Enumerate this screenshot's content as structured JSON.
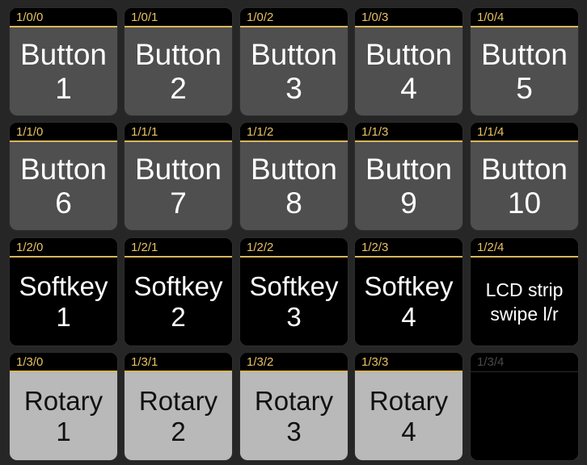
{
  "grid": {
    "rows": [
      [
        {
          "loc": "1/0/0",
          "label": "Button\n1",
          "style": "dark"
        },
        {
          "loc": "1/0/1",
          "label": "Button\n2",
          "style": "dark"
        },
        {
          "loc": "1/0/2",
          "label": "Button\n3",
          "style": "dark"
        },
        {
          "loc": "1/0/3",
          "label": "Button\n4",
          "style": "dark"
        },
        {
          "loc": "1/0/4",
          "label": "Button\n5",
          "style": "dark"
        }
      ],
      [
        {
          "loc": "1/1/0",
          "label": "Button\n6",
          "style": "dark"
        },
        {
          "loc": "1/1/1",
          "label": "Button\n7",
          "style": "dark"
        },
        {
          "loc": "1/1/2",
          "label": "Button\n8",
          "style": "dark"
        },
        {
          "loc": "1/1/3",
          "label": "Button\n9",
          "style": "dark"
        },
        {
          "loc": "1/1/4",
          "label": "Button\n10",
          "style": "dark"
        }
      ],
      [
        {
          "loc": "1/2/0",
          "label": "Softkey\n1",
          "style": "black"
        },
        {
          "loc": "1/2/1",
          "label": "Softkey\n2",
          "style": "black"
        },
        {
          "loc": "1/2/2",
          "label": "Softkey\n3",
          "style": "black"
        },
        {
          "loc": "1/2/3",
          "label": "Softkey\n4",
          "style": "black"
        },
        {
          "loc": "1/2/4",
          "label": "LCD strip\nswipe l/r",
          "style": "black small"
        }
      ],
      [
        {
          "loc": "1/3/0",
          "label": "Rotary\n1",
          "style": "light"
        },
        {
          "loc": "1/3/1",
          "label": "Rotary\n2",
          "style": "light"
        },
        {
          "loc": "1/3/2",
          "label": "Rotary\n3",
          "style": "light"
        },
        {
          "loc": "1/3/3",
          "label": "Rotary\n4",
          "style": "light"
        },
        {
          "loc": "1/3/4",
          "label": "",
          "style": "empty black"
        }
      ]
    ]
  },
  "colors": {
    "background": "#262626",
    "header_accent": "#d9b65a",
    "location_text": "#e8c25f",
    "button_fill": "#4f4f4f",
    "softkey_fill": "#000000",
    "rotary_fill": "#b9b9b9"
  }
}
